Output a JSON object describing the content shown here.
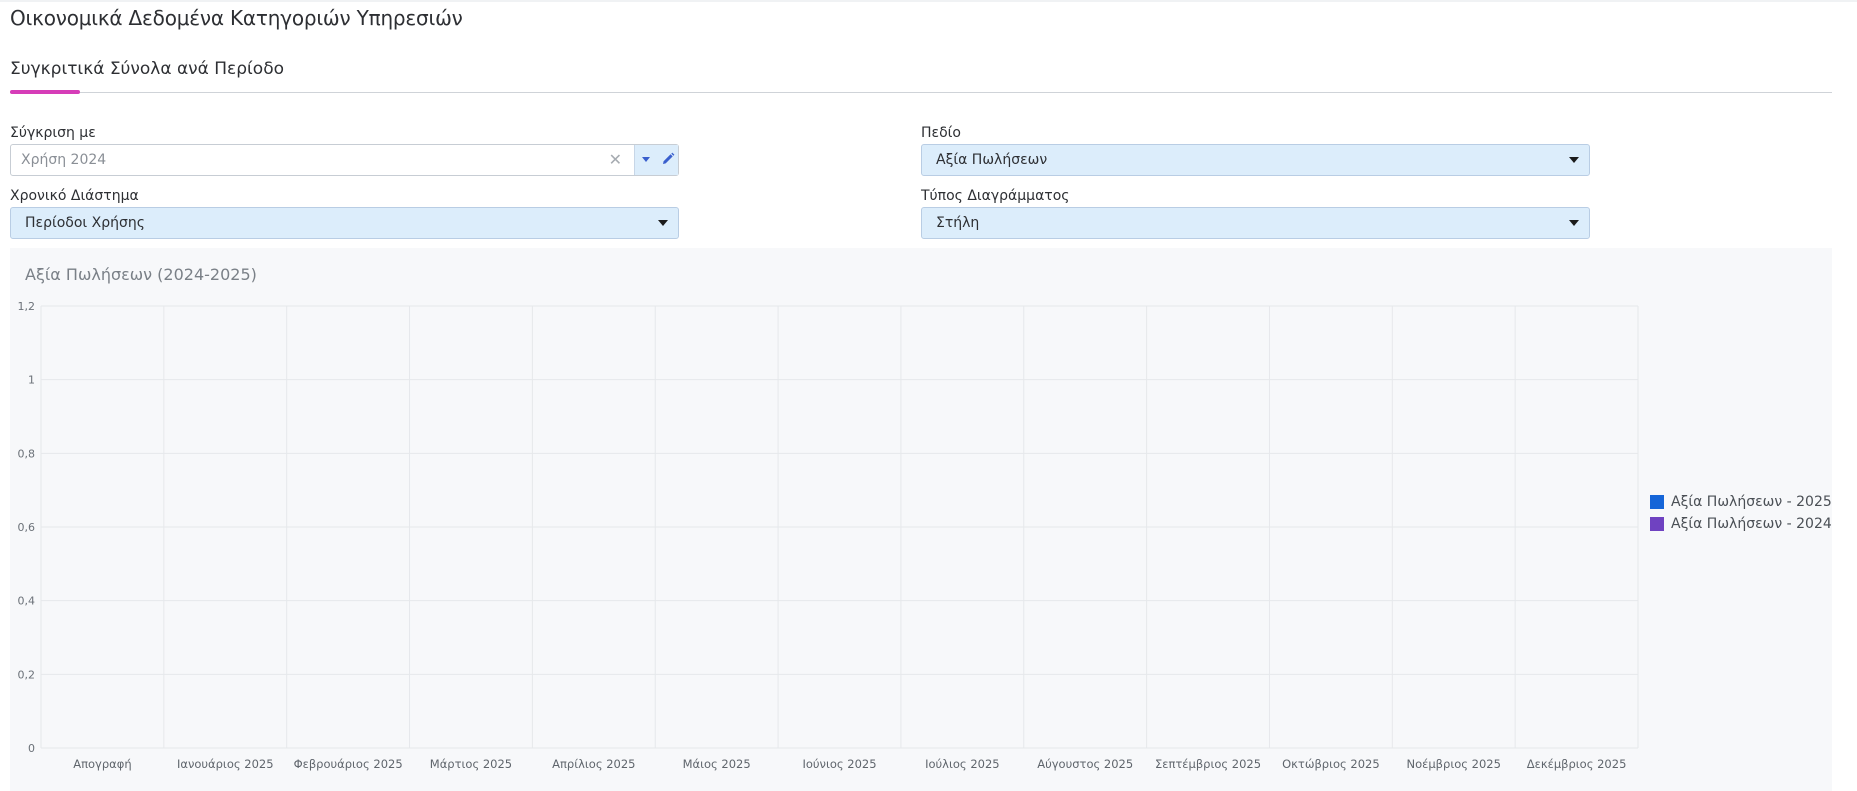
{
  "page": {
    "title": "Οικονομικά Δεδομένα Κατηγοριών Υπηρεσιών"
  },
  "tabs": [
    {
      "label": "Συγκριτικά Σύνολα ανά Περίοδο",
      "active": true
    }
  ],
  "filters": {
    "compare": {
      "label": "Σύγκριση με",
      "value": "Χρήση 2024"
    },
    "field": {
      "label": "Πεδίο",
      "value": "Αξία Πωλήσεων"
    },
    "period": {
      "label": "Χρονικό Διάστημα",
      "value": "Περίοδοι Χρήσης"
    },
    "chart_type": {
      "label": "Τύπος Διαγράμματος",
      "value": "Στήλη"
    }
  },
  "icons": {
    "clear": "close-icon",
    "dropdown": "caret-down-icon",
    "edit": "pencil-icon"
  },
  "colors": {
    "accent": "#d63db8",
    "series_2025": "#1565d8",
    "series_2024": "#6f42c1",
    "select_bg": "#dcedfb"
  },
  "chart_data": {
    "type": "bar",
    "title": "Αξία Πωλήσεων (2024-2025)",
    "xlabel": "",
    "ylabel": "",
    "categories": [
      "Απογραφή",
      "Ιανουάριος 2025",
      "Φεβρουάριος 2025",
      "Μάρτιος 2025",
      "Απρίλιος 2025",
      "Μάιος 2025",
      "Ιούνιος 2025",
      "Ιούλιος 2025",
      "Αύγουστος 2025",
      "Σεπτέμβριος 2025",
      "Οκτώβριος 2025",
      "Νοέμβριος 2025",
      "Δεκέμβριος 2025"
    ],
    "series": [
      {
        "name": "Αξία Πωλήσεων - 2025",
        "color": "#1565d8",
        "values": [
          0,
          0,
          0,
          0,
          0,
          0,
          0,
          0,
          0,
          0,
          0,
          0,
          0
        ]
      },
      {
        "name": "Αξία Πωλήσεων - 2024",
        "color": "#6f42c1",
        "values": [
          0,
          0,
          0,
          0,
          0,
          0,
          0,
          0,
          0,
          0,
          0,
          0,
          0
        ]
      }
    ],
    "ylim": [
      0,
      1.2
    ],
    "yticks": [
      "0",
      "0,2",
      "0,4",
      "0,6",
      "0,8",
      "1",
      "1,2"
    ],
    "grid": true,
    "legend_position": "right"
  }
}
